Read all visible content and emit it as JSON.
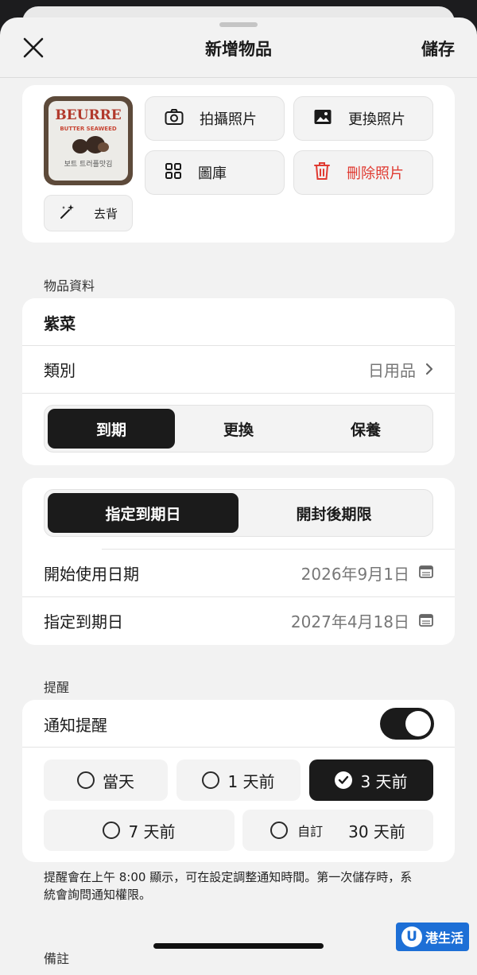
{
  "nav": {
    "title": "新增物品",
    "save_label": "儲存"
  },
  "photo": {
    "thumb_brand": "BEURRE",
    "thumb_sub": "BUTTER SEAWEED",
    "thumb_kr": "보트 트러플맛김",
    "remove_bg_label": "去背",
    "take_photo_label": "拍攝照片",
    "replace_photo_label": "更換照片",
    "gallery_label": "圖庫",
    "delete_photo_label": "刪除照片"
  },
  "item_section": {
    "label": "物品資料",
    "name_value": "紫菜",
    "category_label": "類別",
    "category_value": "日用品",
    "tabs": [
      "到期",
      "更換",
      "保養"
    ]
  },
  "expiry": {
    "modes": [
      "指定到期日",
      "開封後期限"
    ],
    "start_label": "開始使用日期",
    "start_value": "2026年9月1日",
    "expiry_label": "指定到期日",
    "expiry_value": "2027年4月18日"
  },
  "reminder": {
    "label": "提醒",
    "toggle_label": "通知提醒",
    "toggle_on": true,
    "opt_same_day": "當天",
    "opt_1day": "1 天前",
    "opt_3day": "3 天前",
    "opt_7day": "7 天前",
    "opt_custom": "自訂",
    "opt_custom_value": "30 天前",
    "selected": "3 天前",
    "hint": "提醒會在上午 8:00 顯示，可在設定調整通知時間。第一次儲存時，系統會詢問通知權限。"
  },
  "notes": {
    "label": "備註"
  },
  "watermark": {
    "letter": "U",
    "text": "港生活"
  },
  "colors": {
    "accent": "#1b1b1b",
    "danger": "#e03a31",
    "background": "#f2f2f2"
  }
}
